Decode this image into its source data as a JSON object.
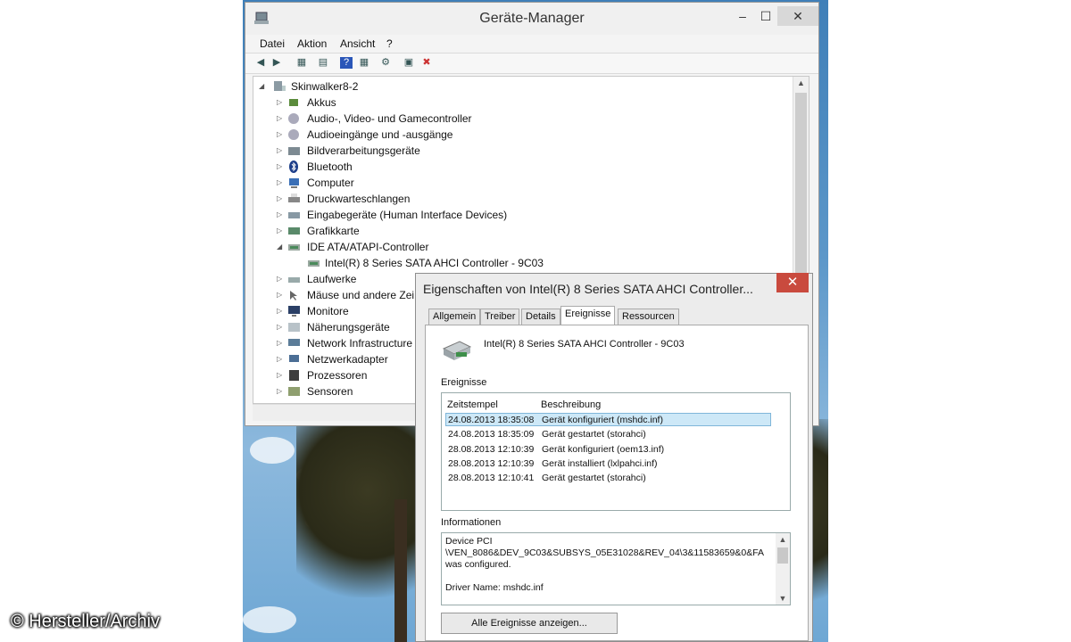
{
  "watermark": "© Hersteller/Archiv",
  "device_manager": {
    "title": "Geräte-Manager",
    "window_controls": {
      "minimize": "–",
      "maximize": "☐",
      "close": "✕"
    },
    "menu": [
      "Datei",
      "Aktion",
      "Ansicht",
      "?"
    ],
    "tree": {
      "root": "Skinwalker8-2",
      "items": [
        "Akkus",
        "Audio-, Video- und Gamecontroller",
        "Audioeingänge und -ausgänge",
        "Bildverarbeitungsgeräte",
        "Bluetooth",
        "Computer",
        "Druckwarteschlangen",
        "Eingabegeräte (Human Interface Devices)",
        "Grafikkarte",
        "IDE ATA/ATAPI-Controller",
        "Intel(R) 8 Series SATA AHCI Controller - 9C03",
        "Laufwerke",
        "Mäuse und andere Zei",
        "Monitore",
        "Näherungsgeräte",
        "Network Infrastructure",
        "Netzwerkadapter",
        "Prozessoren",
        "Sensoren"
      ]
    }
  },
  "properties_dialog": {
    "title": "Eigenschaften von Intel(R) 8 Series SATA AHCI Controller...",
    "close": "✕",
    "tabs": [
      "Allgemein",
      "Treiber",
      "Details",
      "Ereignisse",
      "Ressourcen"
    ],
    "active_tab": "Ereignisse",
    "device_name": "Intel(R) 8 Series SATA AHCI Controller - 9C03",
    "events_label": "Ereignisse",
    "columns": {
      "time": "Zeitstempel",
      "desc": "Beschreibung"
    },
    "events": [
      {
        "time": "24.08.2013 18:35:08",
        "desc": "Gerät konfiguriert (mshdc.inf)"
      },
      {
        "time": "24.08.2013 18:35:09",
        "desc": "Gerät gestartet (storahci)"
      },
      {
        "time": "28.08.2013 12:10:39",
        "desc": "Gerät konfiguriert (oem13.inf)"
      },
      {
        "time": "28.08.2013 12:10:39",
        "desc": "Gerät installiert (lxlpahci.inf)"
      },
      {
        "time": "28.08.2013 12:10:41",
        "desc": "Gerät gestartet (storahci)"
      }
    ],
    "info_label": "Informationen",
    "info_lines": [
      "Device PCI",
      "\\VEN_8086&DEV_9C03&SUBSYS_05E31028&REV_04\\3&11583659&0&FA",
      "was configured.",
      "",
      "Driver Name: mshdc.inf"
    ],
    "all_events_button": "Alle Ereignisse anzeigen..."
  }
}
